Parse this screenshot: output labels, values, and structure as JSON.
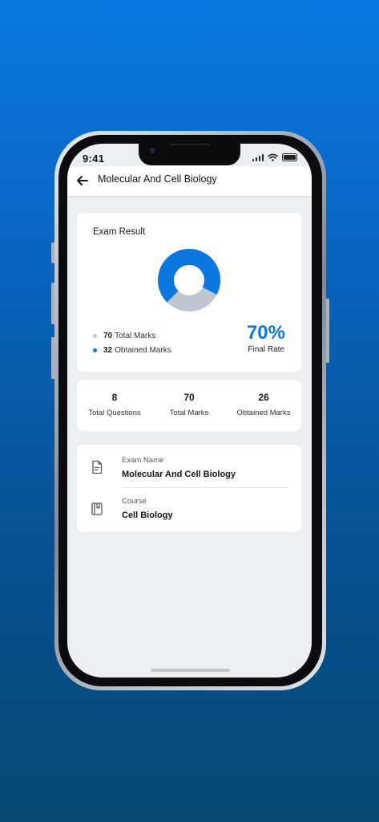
{
  "status_bar": {
    "time": "9:41"
  },
  "header": {
    "title": "Molecular And Cell Biology"
  },
  "exam_result": {
    "title": "Exam Result",
    "total_marks_value": "70",
    "total_marks_label": "Total Marks",
    "obtained_marks_value": "32",
    "obtained_marks_label": "Obtained Marks",
    "final_rate_value": "70%",
    "final_rate_label": "Final Rate",
    "donut": {
      "filled_fraction": 0.7
    },
    "colors": {
      "filled": "#0a78e0",
      "remaining": "#c0c6d0"
    }
  },
  "stats": [
    {
      "value": "8",
      "label": "Total Questions"
    },
    {
      "value": "70",
      "label": "Total Marks"
    },
    {
      "value": "26",
      "label": "Obtained Marks"
    }
  ],
  "info": {
    "exam_name_label": "Exam Name",
    "exam_name_value": "Molecular And Cell Biology",
    "course_label": "Course",
    "course_value": "Cell Biology"
  },
  "icons": {
    "back": "arrow-left-icon",
    "exam": "document-icon",
    "course": "book-icon"
  }
}
